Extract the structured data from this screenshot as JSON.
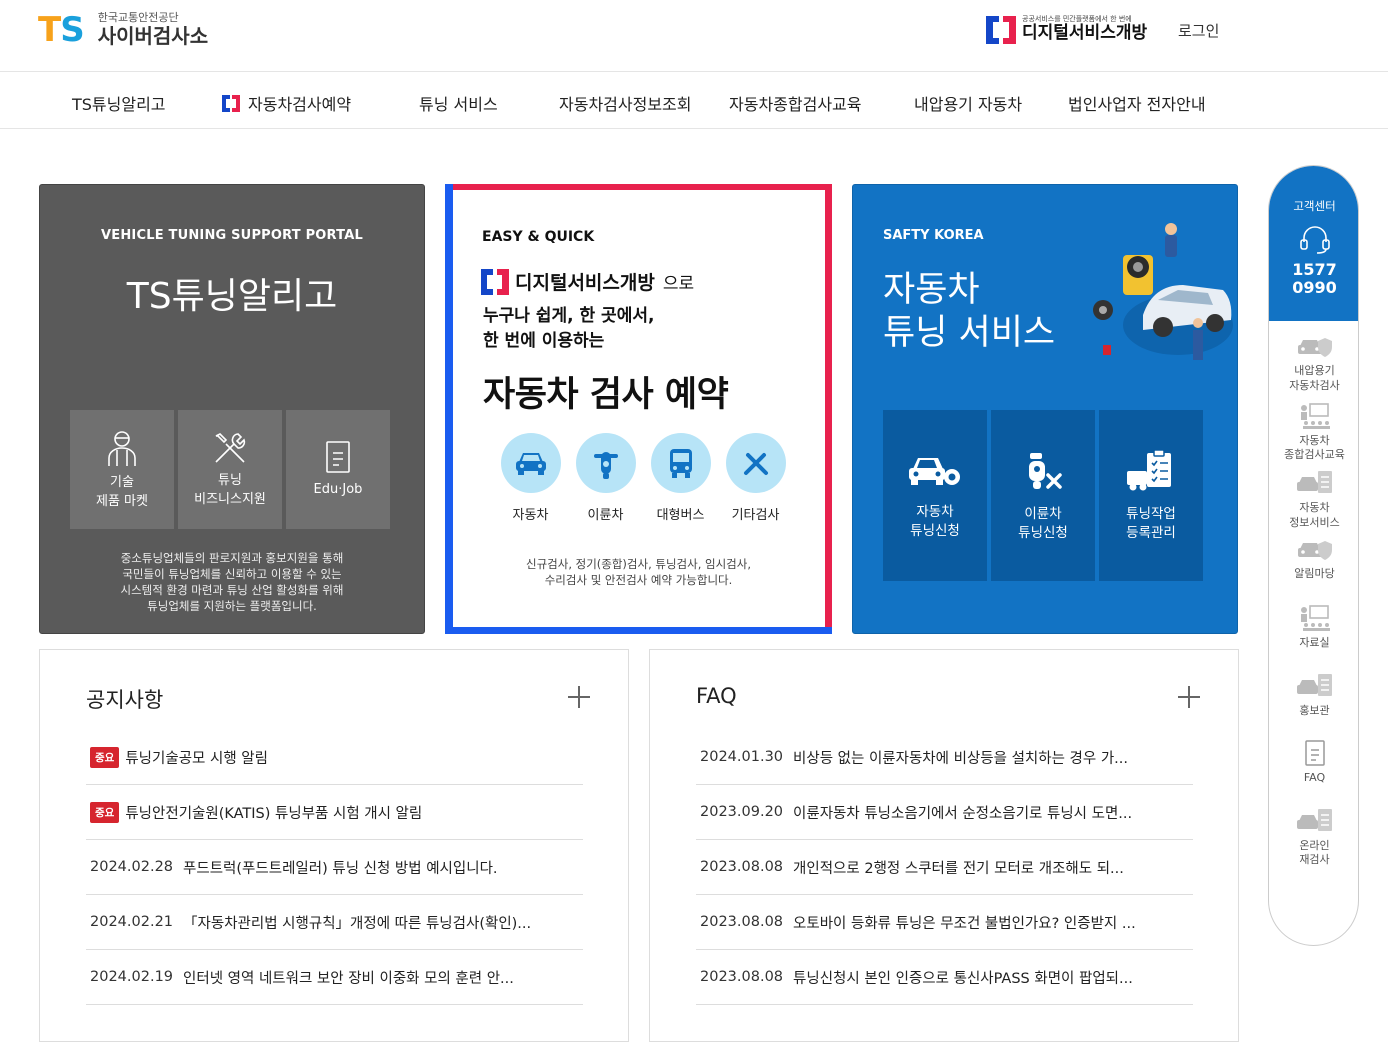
{
  "header": {
    "logo_mark": "TS",
    "logo_sub": "한국교통안전공단",
    "logo_main": "사이버검사소",
    "dso_small": "공공서비스를 민간플랫폼에서 한 번에",
    "dso_big": "디지털서비스개방",
    "login": "로그인"
  },
  "nav": {
    "items": [
      "TS튜닝알리고",
      "자동차검사예약",
      "튜닝 서비스",
      "자동차검사정보조회",
      "자동차종합검사교육",
      "내압용기 자동차",
      "법인사업자 전자안내"
    ]
  },
  "card1": {
    "eyebrow": "VEHICLE TUNING SUPPORT PORTAL",
    "title": "TS튜닝알리고",
    "tiles": [
      {
        "line1": "기술",
        "line2": "제품 마켓",
        "icon": "mechanic-icon"
      },
      {
        "line1": "튜닝",
        "line2": "비즈니스지원",
        "icon": "tools-icon"
      },
      {
        "line1": "Edu·Job",
        "line2": "",
        "icon": "document-icon"
      }
    ],
    "desc": [
      "중소튜닝업체들의 판로지원과 홍보지원을 통해",
      "국민들이 튜닝업체를 신뢰하고 이용할 수 있는",
      "시스템적 환경 마련과 튜닝 산업 활성화를 위해",
      "튜닝업체를 지원하는 플랫폼입니다."
    ]
  },
  "card2": {
    "eyebrow": "EASY & QUICK",
    "brand": "디지털서비스개방",
    "brand_suffix": "으로",
    "lead1": "누구나 쉽게, 한 곳에서,",
    "lead2": "한 번에 이용하는",
    "big": "자동차 검사 예약",
    "categories": [
      {
        "label": "자동차",
        "icon": "car-icon"
      },
      {
        "label": "이륜차",
        "icon": "motorcycle-icon"
      },
      {
        "label": "대형버스",
        "icon": "bus-icon"
      },
      {
        "label": "기타검사",
        "icon": "wrench-icon"
      }
    ],
    "note1": "신규검사, 정기(종합)검사, 튜닝검사, 임시검사,",
    "note2": "수리검사 및 안전검사 예약 가능합니다."
  },
  "card3": {
    "eyebrow": "SAFTY KOREA",
    "title1": "자동차",
    "title2": "튜닝 서비스",
    "tiles": [
      {
        "line1": "자동차",
        "line2": "튜닝신청",
        "icon": "car-gear-icon"
      },
      {
        "line1": "이륜차",
        "line2": "튜닝신청",
        "icon": "scooter-wrench-icon"
      },
      {
        "line1": "튜닝작업",
        "line2": "등록관리",
        "icon": "clipboard-truck-icon"
      }
    ]
  },
  "notice": {
    "title": "공지사항",
    "items": [
      {
        "badge": "중요",
        "date": "",
        "text": "튜닝기술공모 시행 알림"
      },
      {
        "badge": "중요",
        "date": "",
        "text": "튜닝안전기술원(KATIS) 튜닝부품 시험 개시 알림"
      },
      {
        "badge": "",
        "date": "2024.02.28",
        "text": "푸드트럭(푸드트레일러) 튜닝 신청 방법 예시입니다."
      },
      {
        "badge": "",
        "date": "2024.02.21",
        "text": "「자동차관리법 시행규칙」개정에 따른 튜닝검사(확인)..."
      },
      {
        "badge": "",
        "date": "2024.02.19",
        "text": "인터넷 영역 네트워크 보안 장비 이중화 모의 훈련 안..."
      }
    ]
  },
  "faq": {
    "title": "FAQ",
    "items": [
      {
        "date": "2024.01.30",
        "text": "비상등 없는 이륜자동차에 비상등을 설치하는 경우 가..."
      },
      {
        "date": "2023.09.20",
        "text": "이륜자동차 튜닝소음기에서 순정소음기로 튜닝시 도면..."
      },
      {
        "date": "2023.08.08",
        "text": "개인적으로 2행정 스쿠터를 전기 모터로 개조해도 되..."
      },
      {
        "date": "2023.08.08",
        "text": "오토바이 등화류 튜닝은 무조건 불법인가요? 인증받지 ..."
      },
      {
        "date": "2023.08.08",
        "text": "튜닝신청시 본인 인증으로 통신사PASS 화면이 팝업되..."
      }
    ]
  },
  "sidebar": {
    "cs_label": "고객센터",
    "cs_num1": "1577",
    "cs_num2": "0990",
    "items": [
      {
        "line1": "내압용기",
        "line2": "자동차검사"
      },
      {
        "line1": "자동차",
        "line2": "종합검사교육"
      },
      {
        "line1": "자동차",
        "line2": "정보서비스"
      },
      {
        "line1": "알림마당",
        "line2": ""
      },
      {
        "line1": "자료실",
        "line2": ""
      },
      {
        "line1": "홍보관",
        "line2": ""
      },
      {
        "line1": "FAQ",
        "line2": ""
      },
      {
        "line1": "온라인",
        "line2": "재검사"
      }
    ]
  },
  "colors": {
    "brand_blue": "#1273c4",
    "dso_red": "#e8214d",
    "dso_blue": "#1446c8",
    "badge_red": "#d6252e"
  }
}
